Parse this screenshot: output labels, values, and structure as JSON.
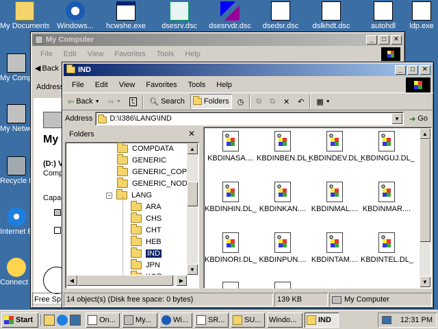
{
  "desktop": {
    "top_icons": [
      "My Documents",
      "Windows...",
      "hcwshe.exe",
      "dsesrv.dsc",
      "dsesrvdr.dsc",
      "dsedsr.dsc",
      "dslkhdt.dsc",
      "autohdl",
      "ldp.exe"
    ],
    "left_icons": [
      "My Computer",
      "My Network Places",
      "Recycle Bin",
      "Internet Explorer",
      "Connect to the Internet"
    ]
  },
  "back_window": {
    "title": "My Computer",
    "menu": [
      "File",
      "Edit",
      "View",
      "Favorites",
      "Tools",
      "Help"
    ],
    "back_label": "Back",
    "address_label": "Address",
    "panel_title": "My",
    "drive_label": "(D:) V",
    "drive_sub": "Comp",
    "capacity_label": "Capac",
    "status_text": "Free Sp"
  },
  "front_window": {
    "title": "IND",
    "menu": [
      "File",
      "Edit",
      "View",
      "Favorites",
      "Tools",
      "Help"
    ],
    "toolbar": {
      "back": "Back",
      "search": "Search",
      "folders": "Folders"
    },
    "address_label": "Address",
    "address_value": "D:\\I386\\LANG\\IND",
    "go_label": "Go",
    "folders_pane_title": "Folders",
    "tree": [
      {
        "label": "COMPDATA",
        "indent": 1,
        "expander": ""
      },
      {
        "label": "GENERIC",
        "indent": 1,
        "expander": ""
      },
      {
        "label": "GENERIC_COPYA",
        "indent": 1,
        "expander": ""
      },
      {
        "label": "GENERIC_NODEL",
        "indent": 1,
        "expander": ""
      },
      {
        "label": "LANG",
        "indent": 1,
        "expander": "−"
      },
      {
        "label": "ARA",
        "indent": 2,
        "expander": ""
      },
      {
        "label": "CHS",
        "indent": 2,
        "expander": ""
      },
      {
        "label": "CHT",
        "indent": 2,
        "expander": ""
      },
      {
        "label": "HEB",
        "indent": 2,
        "expander": ""
      },
      {
        "label": "IND",
        "indent": 2,
        "expander": "",
        "selected": true
      },
      {
        "label": "JPN",
        "indent": 2,
        "expander": ""
      },
      {
        "label": "KOR",
        "indent": 2,
        "expander": ""
      }
    ],
    "files": [
      "KBDINASA....",
      "KBDINBEN.DL_",
      "KBDINDEV.DL_",
      "KBDINGUJ.DL_",
      "KBDINHIN.DL_",
      "KBDINKAN....",
      "KBDINMAL....",
      "KBDINMAR....",
      "KBDINORI.DL_",
      "KBDINPUN....",
      "KBDINTAM....",
      "KBDINTEL.DL_"
    ],
    "status": {
      "objects": "14 object(s) (Disk free space: 0 bytes)",
      "size": "139 KB",
      "zone": "My Computer"
    }
  },
  "taskbar": {
    "start_label": "Start",
    "tasks": [
      "On...",
      "My...",
      "Wi...",
      "SR...",
      "SU...",
      "Windo...",
      "IND"
    ],
    "active_task": "IND",
    "clock": "12:31 PM"
  },
  "colors": {
    "desktop": "#3a6ea5",
    "title_active": "#0a246a",
    "window_face": "#d4d0c8",
    "selection": "#0a246a"
  }
}
